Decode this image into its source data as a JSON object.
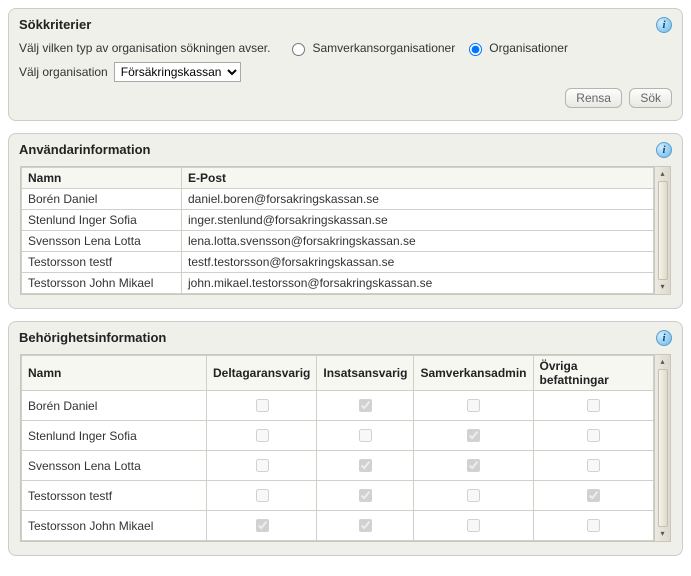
{
  "search": {
    "title": "Sökkriterier",
    "type_label": "Välj vilken typ av organisation sökningen avser.",
    "radio_samverkan": "Samverkansorganisationer",
    "radio_org": "Organisationer",
    "org_label": "Välj organisation",
    "org_options": [
      "Försäkringskassan"
    ],
    "org_selected": "Försäkringskassan",
    "btn_clear": "Rensa",
    "btn_search": "Sök"
  },
  "userinfo": {
    "title": "Användarinformation",
    "cols": {
      "name": "Namn",
      "email": "E-Post"
    },
    "rows": [
      {
        "name": "Borén Daniel",
        "email": "daniel.boren@forsakringskassan.se"
      },
      {
        "name": "Stenlund Inger Sofia",
        "email": "inger.stenlund@forsakringskassan.se"
      },
      {
        "name": "Svensson Lena Lotta",
        "email": "lena.lotta.svensson@forsakringskassan.se"
      },
      {
        "name": "Testorsson testf",
        "email": "testf.testorsson@forsakringskassan.se"
      },
      {
        "name": "Testorsson John Mikael",
        "email": "john.mikael.testorsson@forsakringskassan.se"
      }
    ]
  },
  "perm": {
    "title": "Behörighetsinformation",
    "cols": {
      "name": "Namn",
      "deltagar": "Deltagaransvarig",
      "insats": "Insatsansvarig",
      "samverkan": "Samverkansadmin",
      "ovriga": "Övriga befattningar"
    },
    "rows": [
      {
        "name": "Borén Daniel",
        "deltagar": false,
        "insats": true,
        "samverkan": false,
        "ovriga": false
      },
      {
        "name": "Stenlund Inger Sofia",
        "deltagar": false,
        "insats": false,
        "samverkan": true,
        "ovriga": false
      },
      {
        "name": "Svensson Lena Lotta",
        "deltagar": false,
        "insats": true,
        "samverkan": true,
        "ovriga": false
      },
      {
        "name": "Testorsson testf",
        "deltagar": false,
        "insats": true,
        "samverkan": false,
        "ovriga": true
      },
      {
        "name": "Testorsson John Mikael",
        "deltagar": true,
        "insats": true,
        "samverkan": false,
        "ovriga": false
      }
    ]
  }
}
